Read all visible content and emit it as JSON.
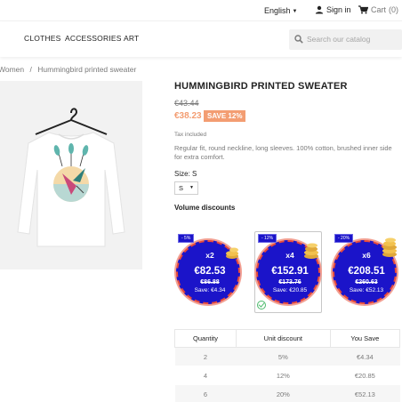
{
  "header": {
    "language": "English",
    "signin": "Sign in",
    "cart_label": "Cart",
    "cart_count": "(0)"
  },
  "nav": {
    "items": [
      "CLOTHES",
      "ACCESSORIES",
      "ART"
    ],
    "search_placeholder": "Search our catalog"
  },
  "breadcrumb": {
    "items": [
      "Women",
      "Hummingbird printed sweater"
    ],
    "separator": "/"
  },
  "product": {
    "title": "HUMMINGBIRD PRINTED SWEATER",
    "old_price": "€43.44",
    "price": "€38.23",
    "save_badge": "SAVE 12%",
    "tax": "Tax included",
    "description": "Regular fit, round neckline, long sleeves. 100% cotton, brushed inner side for extra comfort.",
    "size_label": "Size: S",
    "size_value": "S"
  },
  "volume": {
    "title": "Volume discounts",
    "cards": [
      {
        "tag": "- 5%",
        "qty": "x2",
        "price": "€82.53",
        "old": "€86.88",
        "save": "Save: €4.34",
        "selected": false
      },
      {
        "tag": "- 12%",
        "qty": "x4",
        "price": "€152.91",
        "old": "€173.76",
        "save": "Save: €20.85",
        "selected": true
      },
      {
        "tag": "- 20%",
        "qty": "x6",
        "price": "€208.51",
        "old": "€260.63",
        "save": "Save: €52.13",
        "selected": false
      }
    ],
    "table": {
      "headers": [
        "Quantity",
        "Unit discount",
        "You Save"
      ],
      "rows": [
        [
          "2",
          "5%",
          "€4.34"
        ],
        [
          "4",
          "12%",
          "€20.85"
        ],
        [
          "6",
          "20%",
          "€52.13"
        ]
      ]
    }
  },
  "colors": {
    "accent": "#f39d72",
    "card_blue": "#1b14c9",
    "card_border": "#e74a3b",
    "check_green": "#4cbb6c"
  }
}
